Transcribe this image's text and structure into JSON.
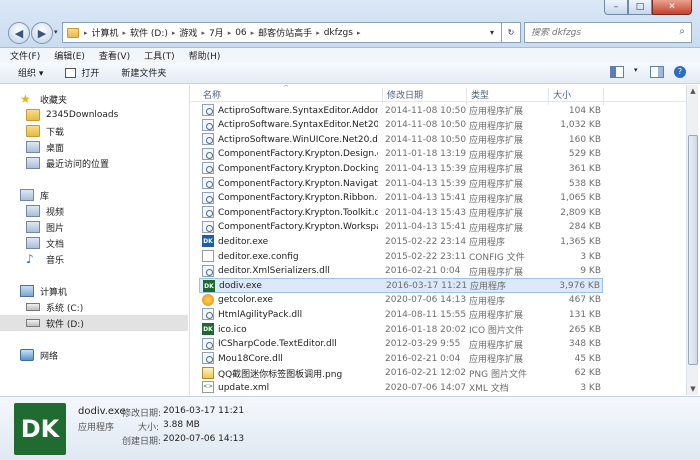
{
  "window": {
    "controls": {
      "min": "–",
      "max": "□",
      "close": "✕"
    }
  },
  "address": {
    "segments": [
      "计算机",
      "软件 (D:)",
      "游戏",
      "7月",
      "06",
      "邮客仿站高手",
      "dkfzgs"
    ]
  },
  "search": {
    "placeholder": "搜索 dkfzgs"
  },
  "menu": [
    "文件(F)",
    "编辑(E)",
    "查看(V)",
    "工具(T)",
    "帮助(H)"
  ],
  "toolbar": {
    "organize": "组织 ▾",
    "open": "打开",
    "new_folder": "新建文件夹"
  },
  "nav": {
    "favorites": "收藏夹",
    "fav_items": [
      "2345Downloads",
      "下载",
      "桌面",
      "最近访问的位置"
    ],
    "library": "库",
    "lib_items": [
      "视频",
      "图片",
      "文档",
      "音乐"
    ],
    "computer": "计算机",
    "comp_items": [
      "系统 (C:)",
      "软件 (D:)"
    ],
    "network": "网络"
  },
  "columns": {
    "name": "名称",
    "date": "修改日期",
    "type": "类型",
    "size": "大小"
  },
  "files": [
    {
      "name": "ActiproSoftware.SyntaxEditor.Addons...",
      "date": "2014-11-08 10:50",
      "type": "应用程序扩展",
      "size": "104 KB",
      "icon": "dll"
    },
    {
      "name": "ActiproSoftware.SyntaxEditor.Net20.dll",
      "date": "2014-11-08 10:50",
      "type": "应用程序扩展",
      "size": "1,032 KB",
      "icon": "dll"
    },
    {
      "name": "ActiproSoftware.WinUICore.Net20.dll",
      "date": "2014-11-08 10:50",
      "type": "应用程序扩展",
      "size": "160 KB",
      "icon": "dll"
    },
    {
      "name": "ComponentFactory.Krypton.Design.dll",
      "date": "2011-01-18 13:19",
      "type": "应用程序扩展",
      "size": "529 KB",
      "icon": "dll"
    },
    {
      "name": "ComponentFactory.Krypton.Docking...",
      "date": "2011-04-13 15:39",
      "type": "应用程序扩展",
      "size": "361 KB",
      "icon": "dll"
    },
    {
      "name": "ComponentFactory.Krypton.Navigato...",
      "date": "2011-04-13 15:39",
      "type": "应用程序扩展",
      "size": "538 KB",
      "icon": "dll"
    },
    {
      "name": "ComponentFactory.Krypton.Ribbon.dll",
      "date": "2011-04-13 15:41",
      "type": "应用程序扩展",
      "size": "1,065 KB",
      "icon": "dll"
    },
    {
      "name": "ComponentFactory.Krypton.Toolkit.dll",
      "date": "2011-04-13 15:43",
      "type": "应用程序扩展",
      "size": "2,809 KB",
      "icon": "dll"
    },
    {
      "name": "ComponentFactory.Krypton.Workspa...",
      "date": "2011-04-13 15:41",
      "type": "应用程序扩展",
      "size": "284 KB",
      "icon": "dll"
    },
    {
      "name": "deditor.exe",
      "date": "2015-02-22 23:14",
      "type": "应用程序",
      "size": "1,365 KB",
      "icon": "exe-dk"
    },
    {
      "name": "deditor.exe.config",
      "date": "2015-02-22 23:11",
      "type": "CONFIG 文件",
      "size": "3 KB",
      "icon": "doc"
    },
    {
      "name": "deditor.XmlSerializers.dll",
      "date": "2016-02-21 0:04",
      "type": "应用程序扩展",
      "size": "9 KB",
      "icon": "dll"
    },
    {
      "name": "dodiv.exe",
      "date": "2016-03-17 11:21",
      "type": "应用程序",
      "size": "3,976 KB",
      "icon": "exe-green",
      "selected": true
    },
    {
      "name": "getcolor.exe",
      "date": "2020-07-06 14:13",
      "type": "应用程序",
      "size": "467 KB",
      "icon": "getcolor"
    },
    {
      "name": "HtmlAgilityPack.dll",
      "date": "2014-08-11 15:55",
      "type": "应用程序扩展",
      "size": "131 KB",
      "icon": "dll"
    },
    {
      "name": "ico.ico",
      "date": "2016-01-18 20:02",
      "type": "ICO 图片文件",
      "size": "265 KB",
      "icon": "exe-green"
    },
    {
      "name": "ICSharpCode.TextEditor.dll",
      "date": "2012-03-29 9:55",
      "type": "应用程序扩展",
      "size": "348 KB",
      "icon": "dll"
    },
    {
      "name": "Mou18Core.dll",
      "date": "2016-02-21 0:04",
      "type": "应用程序扩展",
      "size": "45 KB",
      "icon": "dll"
    },
    {
      "name": "QQ截图迷你标签图板调用.png",
      "date": "2016-02-21 12:02",
      "type": "PNG 图片文件",
      "size": "62 KB",
      "icon": "png"
    },
    {
      "name": "update.xml",
      "date": "2020-07-06 14:07",
      "type": "XML 文档",
      "size": "3 KB",
      "icon": "xml"
    }
  ],
  "details": {
    "icon_text": "DK",
    "name": "dodiv.exe",
    "type": "应用程序",
    "mod_label": "修改日期:",
    "mod_value": "2016-03-17 11:21",
    "size_label": "大小:",
    "size_value": "3.88 MB",
    "created_label": "创建日期:",
    "created_value": "2020-07-06 14:13"
  }
}
